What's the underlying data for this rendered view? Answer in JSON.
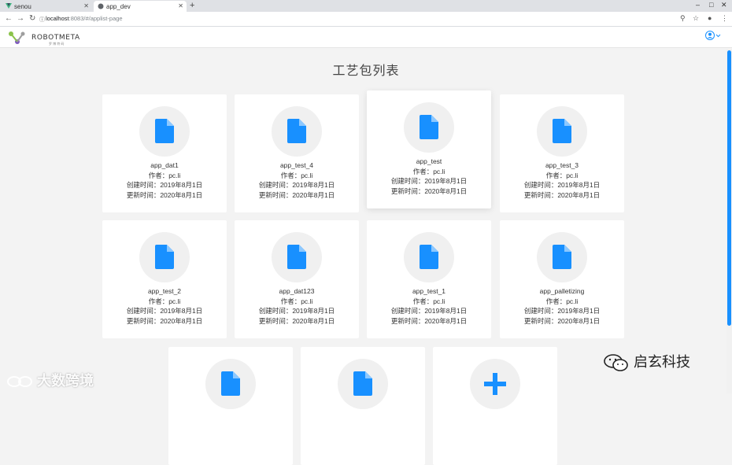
{
  "browser": {
    "tabs": [
      {
        "title": "senou",
        "active": false
      },
      {
        "title": "app_dev",
        "active": true
      }
    ],
    "url_host": "localhost",
    "url_rest": ":8083/#/applist-page"
  },
  "page": {
    "title": "工艺包列表",
    "logo_text": "ROBOTMETA",
    "logo_sub": "罗 博 特 码"
  },
  "cards": [
    {
      "name": "app_dat1",
      "author": "作者：pc.li",
      "created": "创建时间：2019年8月1日",
      "updated": "更新时间：2020年8月1日"
    },
    {
      "name": "app_test_4",
      "author": "作者：pc.li",
      "created": "创建时间：2019年8月1日",
      "updated": "更新时间：2020年8月1日"
    },
    {
      "name": "app_test",
      "author": "作者：pc.li",
      "created": "创建时间：2019年8月1日",
      "updated": "更新时间：2020年8月1日"
    },
    {
      "name": "app_test_3",
      "author": "作者：pc.li",
      "created": "创建时间：2019年8月1日",
      "updated": "更新时间：2020年8月1日"
    },
    {
      "name": "app_test_2",
      "author": "作者：pc.li",
      "created": "创建时间：2019年8月1日",
      "updated": "更新时间：2020年8月1日"
    },
    {
      "name": "app_dat123",
      "author": "作者：pc.li",
      "created": "创建时间：2019年8月1日",
      "updated": "更新时间：2020年8月1日"
    },
    {
      "name": "app_test_1",
      "author": "作者：pc.li",
      "created": "创建时间：2019年8月1日",
      "updated": "更新时间：2020年8月1日"
    },
    {
      "name": "app_palletizing",
      "author": "作者：pc.li",
      "created": "创建时间：2019年8月1日",
      "updated": "更新时间：2020年8月1日"
    }
  ],
  "watermarks": {
    "left": "大数跨境",
    "right": "启玄科技"
  },
  "colors": {
    "accent": "#1890ff",
    "page_bg": "#f3f3f3",
    "card_bg": "#ffffff"
  }
}
